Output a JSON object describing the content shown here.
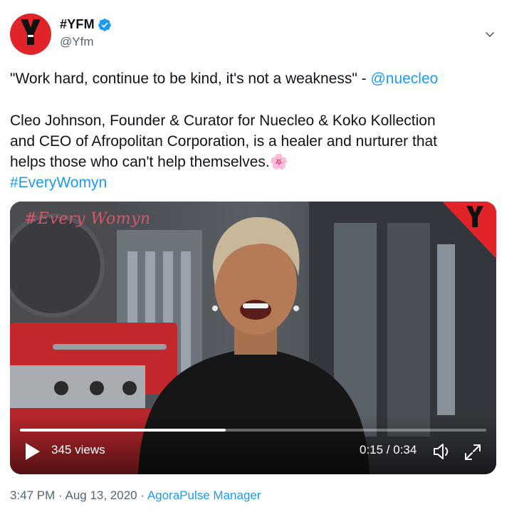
{
  "author": {
    "display_name": "#YFM",
    "handle": "@Yfm",
    "avatar_icon": "yfm-logo-icon",
    "verified_icon": "verified-badge-icon"
  },
  "menu": {
    "icon": "chevron-down-icon"
  },
  "tweet": {
    "quote_text": "\"Work hard, continue to be kind, it's not a weakness\" - ",
    "mention": "@nuecleo",
    "lines": [
      "Cleo Johnson, Founder & Curator for Nuecleo & Koko Kollection",
      "and CEO of Afropolitan Corporation, is a healer and nurturer that",
      "helps those who can't help themselves."
    ],
    "emoji": "🌸",
    "hashtag": "#EveryWomyn"
  },
  "video": {
    "overlay_title": "#Every Womyn",
    "views": "345 views",
    "timecode": "0:15 / 0:34",
    "progress_fraction": 0.441,
    "play_icon": "play-icon",
    "volume_icon": "volume-icon",
    "fullscreen_icon": "fullscreen-icon"
  },
  "footer": {
    "time": "3:47 PM",
    "separator": " · ",
    "date": "Aug 13, 2020",
    "source": "AgoraPulse Manager"
  },
  "colors": {
    "accent": "#1d9bf0",
    "brand_red": "#e0242a",
    "text": "#0f1419",
    "muted": "#536471"
  }
}
